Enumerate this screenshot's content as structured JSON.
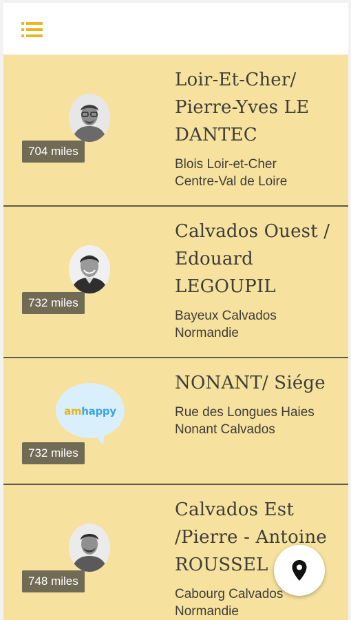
{
  "header": {
    "menu_icon": "list-menu-icon"
  },
  "colors": {
    "accent": "#e8b624",
    "card_background": "#f6e29e",
    "distance_badge": "#716a54",
    "card_divider": "#5e5848",
    "text": "#3e3d38"
  },
  "locations": [
    {
      "title": "Loir-Et-Cher/\nPierre-Yves LE\nDANTEC",
      "address_line1": "Blois Loir-et-Cher",
      "address_line2": "Centre-Val de Loire",
      "distance": "704 miles",
      "image": "person-photo"
    },
    {
      "title": "Calvados Ouest /\nEdouard\nLEGOUPIL",
      "address_line1": "Bayeux Calvados",
      "address_line2": "Normandie",
      "distance": "732 miles",
      "image": "person-photo"
    },
    {
      "title": "NONANT/ Siége",
      "address_line1": "Rue des Longues Haies",
      "address_line2": "Nonant Calvados",
      "distance": "732 miles",
      "image": "amhappy-logo",
      "logo_part1": "am",
      "logo_part2": "happy"
    },
    {
      "title": "Calvados Est\n/Pierre - Antoine\nROUSSEL",
      "address_line1": "Cabourg Calvados",
      "address_line2": "Normandie",
      "distance": "748 miles",
      "image": "person-photo"
    }
  ],
  "fab": {
    "icon": "map-pin-icon"
  }
}
